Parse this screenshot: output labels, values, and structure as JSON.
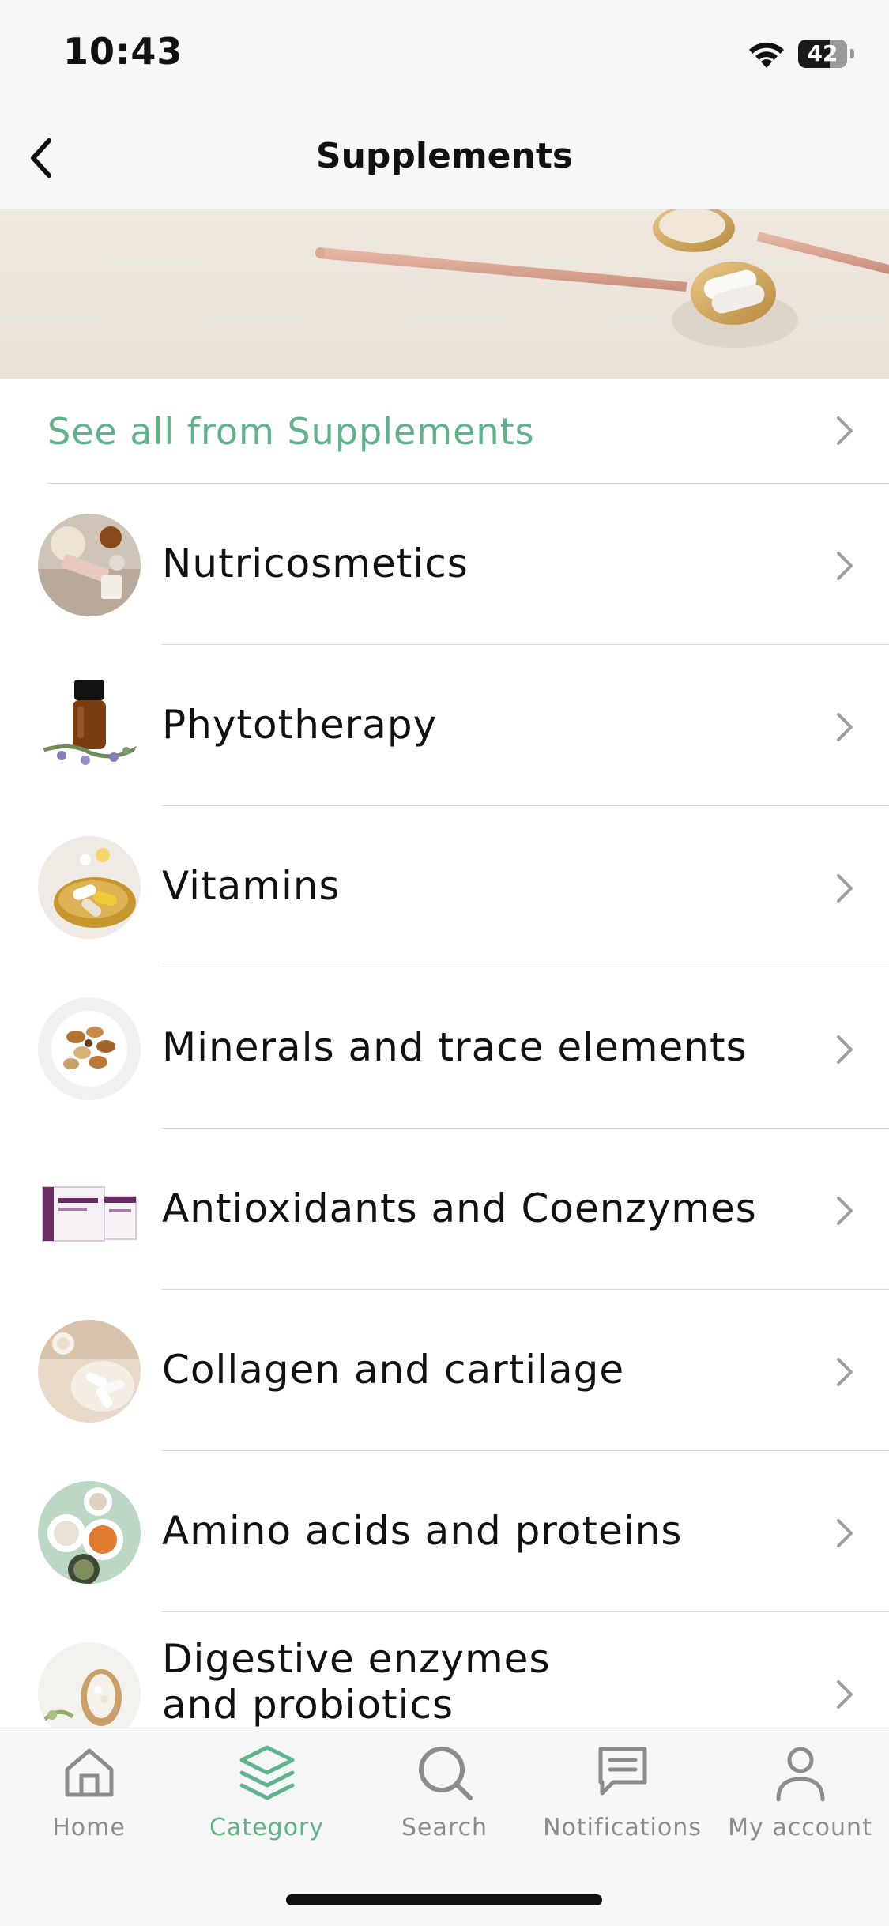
{
  "status_bar": {
    "time": "10:43",
    "battery": "42"
  },
  "nav": {
    "title": "Supplements"
  },
  "see_all": {
    "label": "See all from Supplements"
  },
  "categories": [
    {
      "label": "Nutricosmetics",
      "icon": "nutricosmetics-thumbnail"
    },
    {
      "label": "Phytotherapy",
      "icon": "phytotherapy-thumbnail"
    },
    {
      "label": "Vitamins",
      "icon": "vitamins-thumbnail"
    },
    {
      "label": "Minerals and trace elements",
      "icon": "minerals-thumbnail"
    },
    {
      "label": "Antioxidants and Coenzymes",
      "icon": "antioxidants-thumbnail"
    },
    {
      "label": "Collagen and cartilage",
      "icon": "collagen-thumbnail"
    },
    {
      "label": "Amino acids and proteins",
      "icon": "amino-acids-thumbnail"
    },
    {
      "label_line1": "Digestive enzymes",
      "label_line2": "and probiotics",
      "icon": "digestive-enzymes-thumbnail"
    }
  ],
  "tabs": [
    {
      "label": "Home",
      "icon": "home-icon",
      "active": false
    },
    {
      "label": "Category",
      "icon": "layers-icon",
      "active": true
    },
    {
      "label": "Search",
      "icon": "search-icon",
      "active": false
    },
    {
      "label": "Notifications",
      "icon": "message-icon",
      "active": false
    },
    {
      "label": "My account",
      "icon": "user-icon",
      "active": false
    }
  ],
  "colors": {
    "accent": "#5fb38a",
    "inactive": "#8c8c8c",
    "background": "#f7f7f7"
  }
}
